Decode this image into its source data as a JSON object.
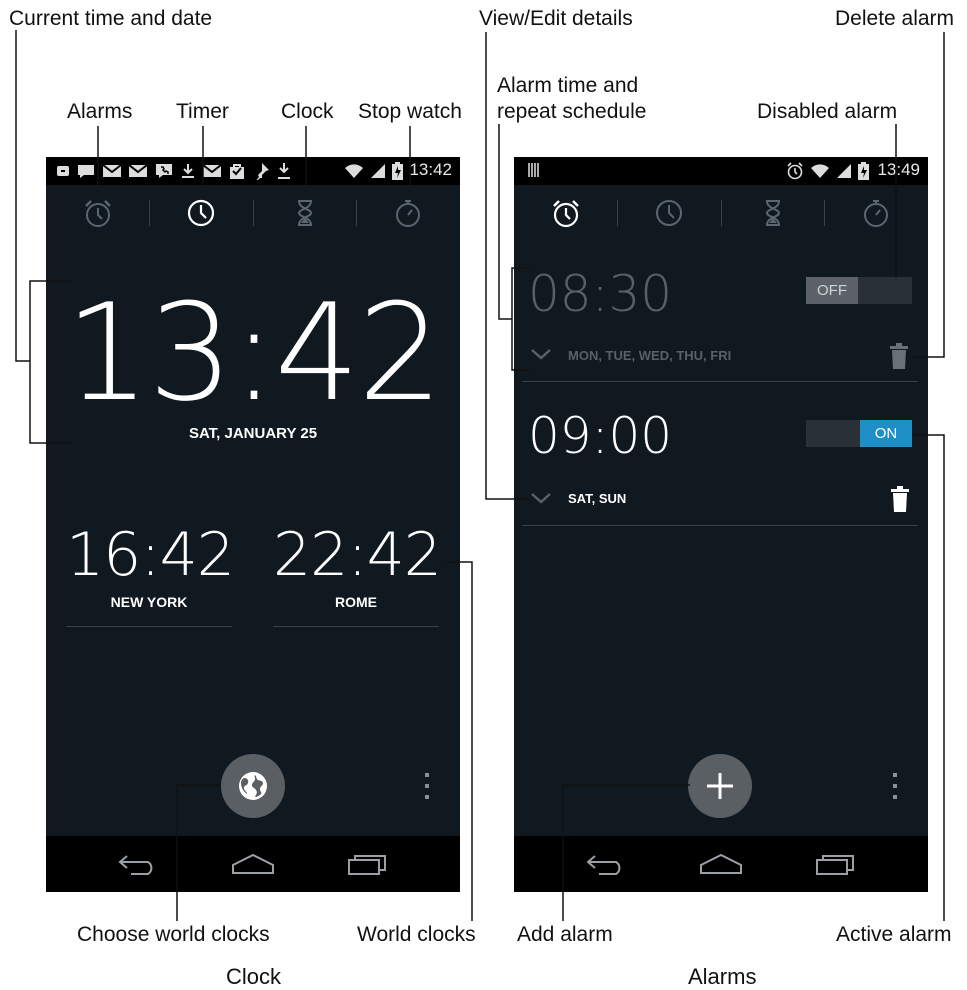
{
  "callouts": {
    "current_time_date": "Current time and date",
    "alarms": "Alarms",
    "timer": "Timer",
    "clock": "Clock",
    "stop_watch": "Stop watch",
    "view_edit": "View/Edit details",
    "alarm_time_line1": "Alarm time and",
    "alarm_time_line2": "repeat schedule",
    "delete_alarm": "Delete alarm",
    "disabled_alarm": "Disabled alarm",
    "choose_world_clocks": "Choose world clocks",
    "world_clocks": "World clocks",
    "add_alarm": "Add alarm",
    "active_alarm": "Active alarm"
  },
  "captions": {
    "left": "Clock",
    "right": "Alarms"
  },
  "clock_screen": {
    "status_time": "13:42",
    "big_time": "13:42",
    "date": "SAT, JANUARY 25",
    "world_clocks": [
      {
        "time": "16:42",
        "city": "NEW YORK"
      },
      {
        "time": "22:42",
        "city": "ROME"
      }
    ],
    "tabs": [
      "alarm-icon",
      "clock-icon",
      "timer-icon",
      "stopwatch-icon"
    ],
    "active_tab": "clock-icon"
  },
  "alarms_screen": {
    "status_time": "13:49",
    "alarms": [
      {
        "time": "08:30",
        "days": "MON, TUE, WED, THU, FRI",
        "toggle": "OFF",
        "enabled": false
      },
      {
        "time": "09:00",
        "days": "SAT, SUN",
        "toggle": "ON",
        "enabled": true
      }
    ],
    "active_tab": "alarm-icon"
  },
  "colors": {
    "screen_bg": "#101820",
    "accent_on": "#1e8fc6",
    "status_bar": "#000000"
  }
}
